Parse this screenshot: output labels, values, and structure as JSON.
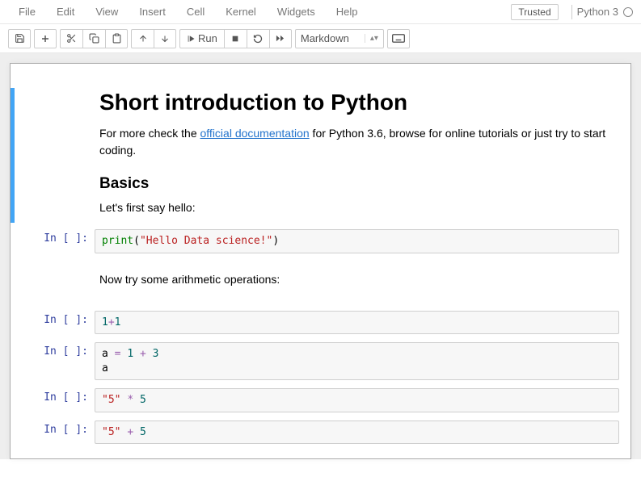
{
  "menu": {
    "file": "File",
    "edit": "Edit",
    "view": "View",
    "insert": "Insert",
    "cell": "Cell",
    "kernel": "Kernel",
    "widgets": "Widgets",
    "help": "Help"
  },
  "header": {
    "trusted": "Trusted",
    "kernel_name": "Python 3"
  },
  "toolbar": {
    "run_label": "Run",
    "celltype_selected": "Markdown"
  },
  "notebook": {
    "md1_h1": "Short introduction to Python",
    "md1_p1_pre": "For more check the ",
    "md1_p1_link": "official documentation",
    "md1_p1_post": " for Python 3.6, browse for online tutorials or just try to start coding.",
    "md1_h2": "Basics",
    "md1_p2": "Let's first say hello:",
    "md2_p": "Now try some arithmetic operations:",
    "prompt_blank": "In [ ]:",
    "code1_fn": "print",
    "code1_paren_open": "(",
    "code1_str": "\"Hello Data science!\"",
    "code1_paren_close": ")",
    "code2_n1": "1",
    "code2_op": "+",
    "code2_n2": "1",
    "code3_l1_var": "a ",
    "code3_l1_eq": "=",
    "code3_l1_sp": " ",
    "code3_l1_n1": "1",
    "code3_l1_op": " + ",
    "code3_l1_n2": "3",
    "code3_l2": "a",
    "code4_str": "\"5\"",
    "code4_sp": " ",
    "code4_op": "*",
    "code4_sp2": " ",
    "code4_n": "5",
    "code5_str": "\"5\"",
    "code5_sp": " ",
    "code5_op": "+",
    "code5_sp2": " ",
    "code5_n": "5"
  }
}
